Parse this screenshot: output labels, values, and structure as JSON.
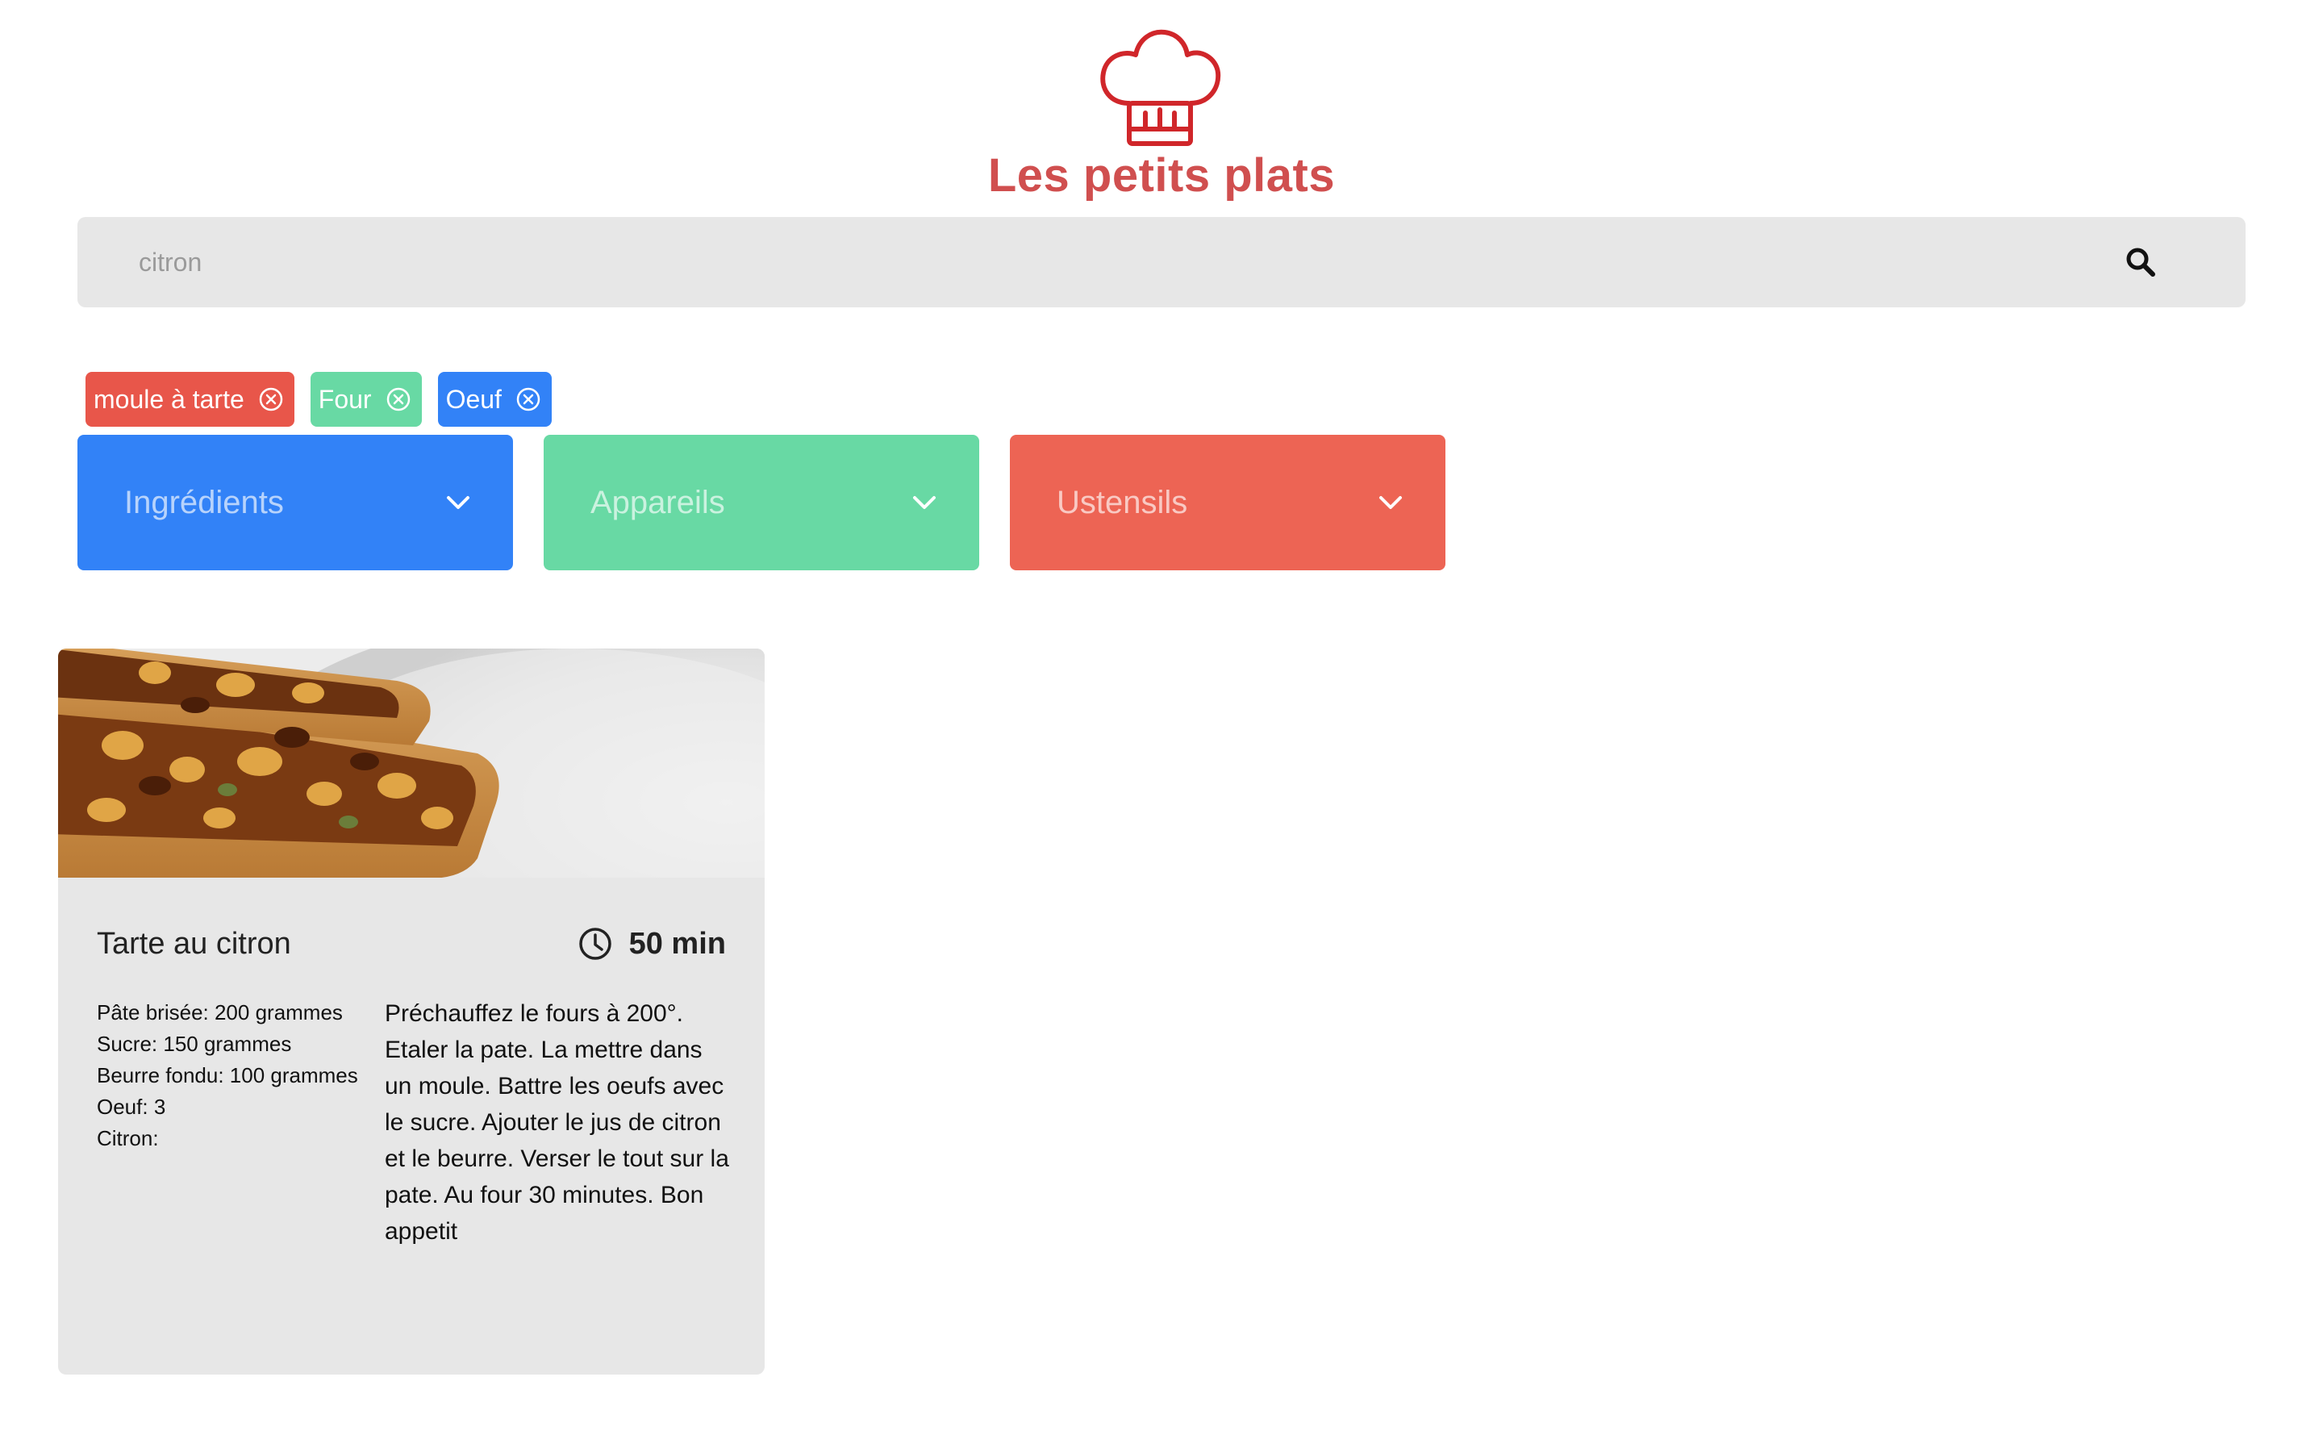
{
  "header": {
    "title": "Les petits plats",
    "logo_icon": "chef-hat-icon",
    "brand_color": "#d04f4f"
  },
  "search": {
    "value": "",
    "placeholder": "citron",
    "icon": "search-icon"
  },
  "tags": [
    {
      "label": "moule à tarte",
      "color": "#e8564a"
    },
    {
      "label": "Four",
      "color": "#68d9a4"
    },
    {
      "label": "Oeuf",
      "color": "#3282f7"
    }
  ],
  "filters": [
    {
      "label": "Ingrédients",
      "color": "#3282f7"
    },
    {
      "label": "Appareils",
      "color": "#68d9a4"
    },
    {
      "label": "Ustensils",
      "color": "#ed6454"
    }
  ],
  "recipes": [
    {
      "title": "Tarte au citron",
      "time": "50 min",
      "ingredients": [
        "Pâte brisée: 200 grammes",
        "Sucre: 150 grammes",
        "Beurre fondu: 100 grammes",
        "Oeuf: 3",
        "Citron:"
      ],
      "description": "Préchauffez le fours à 200°. Etaler la pate. La mettre dans un moule. Battre les oeufs avec le sucre. Ajouter le jus de citron et le beurre. Verser le tout sur la pate. Au four 30 minutes. Bon appetit"
    }
  ]
}
